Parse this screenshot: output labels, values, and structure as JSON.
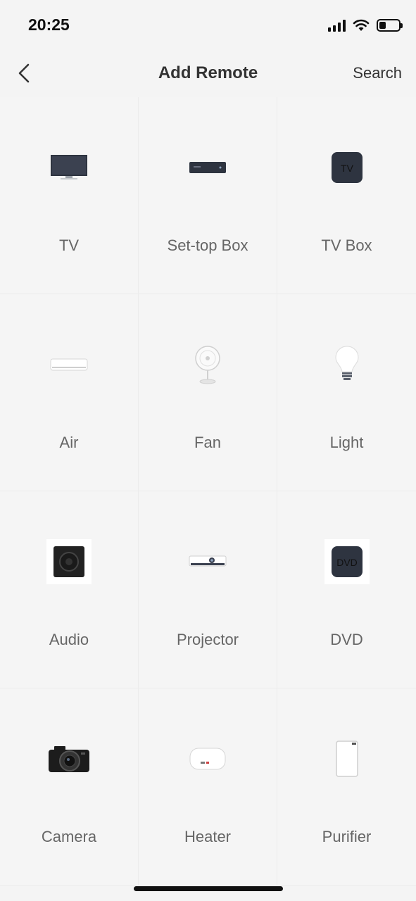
{
  "status": {
    "time": "20:25",
    "battery_level": 0.35
  },
  "header": {
    "title": "Add Remote",
    "search_label": "Search"
  },
  "categories": [
    {
      "label": "TV",
      "icon": "tv-icon"
    },
    {
      "label": "Set-top Box",
      "icon": "set-top-box-icon"
    },
    {
      "label": "TV Box",
      "icon": "tv-box-icon",
      "badge": "TV"
    },
    {
      "label": "Air",
      "icon": "air-conditioner-icon"
    },
    {
      "label": "Fan",
      "icon": "fan-icon"
    },
    {
      "label": "Light",
      "icon": "light-bulb-icon"
    },
    {
      "label": "Audio",
      "icon": "speaker-icon"
    },
    {
      "label": "Projector",
      "icon": "projector-icon"
    },
    {
      "label": "DVD",
      "icon": "dvd-icon",
      "badge": "DVD"
    },
    {
      "label": "Camera",
      "icon": "camera-icon"
    },
    {
      "label": "Heater",
      "icon": "water-heater-icon"
    },
    {
      "label": "Purifier",
      "icon": "air-purifier-icon"
    }
  ],
  "colors": {
    "dark_device": "#2e3440",
    "label": "#666666",
    "title": "#333333"
  }
}
